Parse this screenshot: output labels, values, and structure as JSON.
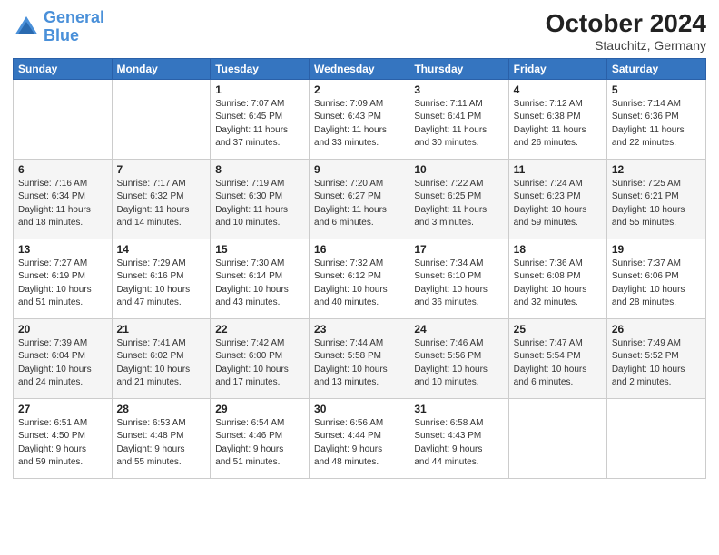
{
  "header": {
    "title": "October 2024",
    "location": "Stauchitz, Germany",
    "logo_line1": "General",
    "logo_line2": "Blue"
  },
  "days_of_week": [
    "Sunday",
    "Monday",
    "Tuesday",
    "Wednesday",
    "Thursday",
    "Friday",
    "Saturday"
  ],
  "weeks": [
    [
      {
        "day": "",
        "info": ""
      },
      {
        "day": "",
        "info": ""
      },
      {
        "day": "1",
        "info": "Sunrise: 7:07 AM\nSunset: 6:45 PM\nDaylight: 11 hours\nand 37 minutes."
      },
      {
        "day": "2",
        "info": "Sunrise: 7:09 AM\nSunset: 6:43 PM\nDaylight: 11 hours\nand 33 minutes."
      },
      {
        "day": "3",
        "info": "Sunrise: 7:11 AM\nSunset: 6:41 PM\nDaylight: 11 hours\nand 30 minutes."
      },
      {
        "day": "4",
        "info": "Sunrise: 7:12 AM\nSunset: 6:38 PM\nDaylight: 11 hours\nand 26 minutes."
      },
      {
        "day": "5",
        "info": "Sunrise: 7:14 AM\nSunset: 6:36 PM\nDaylight: 11 hours\nand 22 minutes."
      }
    ],
    [
      {
        "day": "6",
        "info": "Sunrise: 7:16 AM\nSunset: 6:34 PM\nDaylight: 11 hours\nand 18 minutes."
      },
      {
        "day": "7",
        "info": "Sunrise: 7:17 AM\nSunset: 6:32 PM\nDaylight: 11 hours\nand 14 minutes."
      },
      {
        "day": "8",
        "info": "Sunrise: 7:19 AM\nSunset: 6:30 PM\nDaylight: 11 hours\nand 10 minutes."
      },
      {
        "day": "9",
        "info": "Sunrise: 7:20 AM\nSunset: 6:27 PM\nDaylight: 11 hours\nand 6 minutes."
      },
      {
        "day": "10",
        "info": "Sunrise: 7:22 AM\nSunset: 6:25 PM\nDaylight: 11 hours\nand 3 minutes."
      },
      {
        "day": "11",
        "info": "Sunrise: 7:24 AM\nSunset: 6:23 PM\nDaylight: 10 hours\nand 59 minutes."
      },
      {
        "day": "12",
        "info": "Sunrise: 7:25 AM\nSunset: 6:21 PM\nDaylight: 10 hours\nand 55 minutes."
      }
    ],
    [
      {
        "day": "13",
        "info": "Sunrise: 7:27 AM\nSunset: 6:19 PM\nDaylight: 10 hours\nand 51 minutes."
      },
      {
        "day": "14",
        "info": "Sunrise: 7:29 AM\nSunset: 6:16 PM\nDaylight: 10 hours\nand 47 minutes."
      },
      {
        "day": "15",
        "info": "Sunrise: 7:30 AM\nSunset: 6:14 PM\nDaylight: 10 hours\nand 43 minutes."
      },
      {
        "day": "16",
        "info": "Sunrise: 7:32 AM\nSunset: 6:12 PM\nDaylight: 10 hours\nand 40 minutes."
      },
      {
        "day": "17",
        "info": "Sunrise: 7:34 AM\nSunset: 6:10 PM\nDaylight: 10 hours\nand 36 minutes."
      },
      {
        "day": "18",
        "info": "Sunrise: 7:36 AM\nSunset: 6:08 PM\nDaylight: 10 hours\nand 32 minutes."
      },
      {
        "day": "19",
        "info": "Sunrise: 7:37 AM\nSunset: 6:06 PM\nDaylight: 10 hours\nand 28 minutes."
      }
    ],
    [
      {
        "day": "20",
        "info": "Sunrise: 7:39 AM\nSunset: 6:04 PM\nDaylight: 10 hours\nand 24 minutes."
      },
      {
        "day": "21",
        "info": "Sunrise: 7:41 AM\nSunset: 6:02 PM\nDaylight: 10 hours\nand 21 minutes."
      },
      {
        "day": "22",
        "info": "Sunrise: 7:42 AM\nSunset: 6:00 PM\nDaylight: 10 hours\nand 17 minutes."
      },
      {
        "day": "23",
        "info": "Sunrise: 7:44 AM\nSunset: 5:58 PM\nDaylight: 10 hours\nand 13 minutes."
      },
      {
        "day": "24",
        "info": "Sunrise: 7:46 AM\nSunset: 5:56 PM\nDaylight: 10 hours\nand 10 minutes."
      },
      {
        "day": "25",
        "info": "Sunrise: 7:47 AM\nSunset: 5:54 PM\nDaylight: 10 hours\nand 6 minutes."
      },
      {
        "day": "26",
        "info": "Sunrise: 7:49 AM\nSunset: 5:52 PM\nDaylight: 10 hours\nand 2 minutes."
      }
    ],
    [
      {
        "day": "27",
        "info": "Sunrise: 6:51 AM\nSunset: 4:50 PM\nDaylight: 9 hours\nand 59 minutes."
      },
      {
        "day": "28",
        "info": "Sunrise: 6:53 AM\nSunset: 4:48 PM\nDaylight: 9 hours\nand 55 minutes."
      },
      {
        "day": "29",
        "info": "Sunrise: 6:54 AM\nSunset: 4:46 PM\nDaylight: 9 hours\nand 51 minutes."
      },
      {
        "day": "30",
        "info": "Sunrise: 6:56 AM\nSunset: 4:44 PM\nDaylight: 9 hours\nand 48 minutes."
      },
      {
        "day": "31",
        "info": "Sunrise: 6:58 AM\nSunset: 4:43 PM\nDaylight: 9 hours\nand 44 minutes."
      },
      {
        "day": "",
        "info": ""
      },
      {
        "day": "",
        "info": ""
      }
    ]
  ]
}
